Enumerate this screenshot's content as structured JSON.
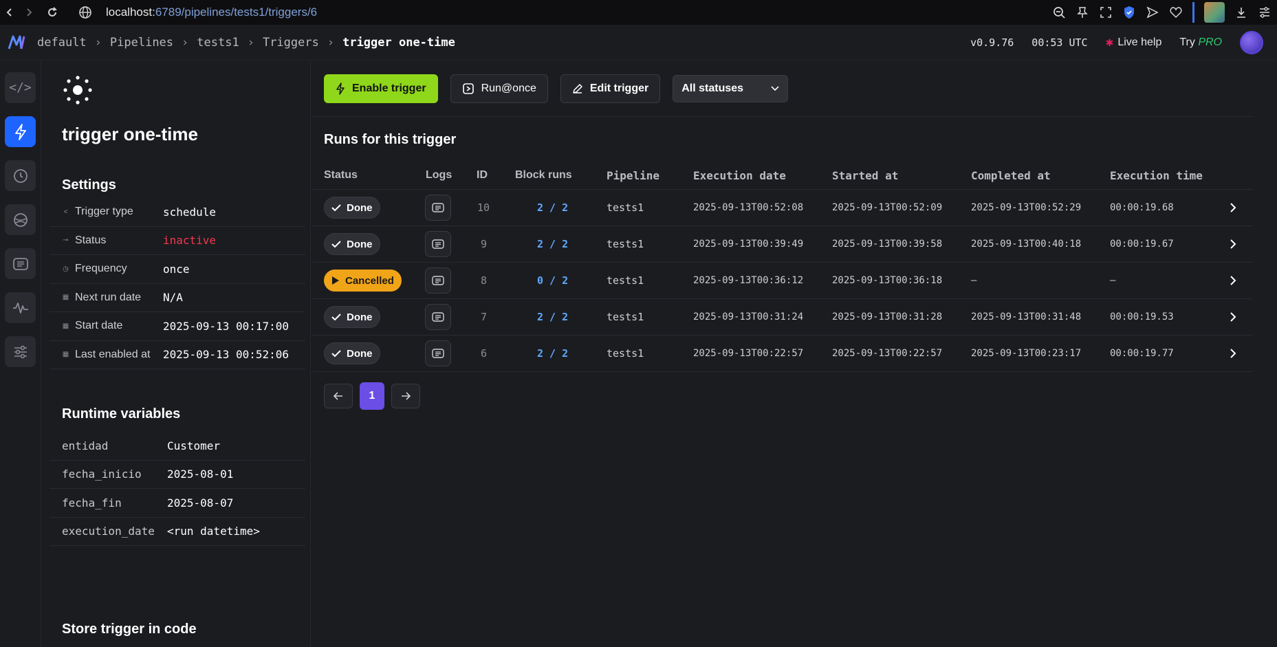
{
  "browser": {
    "url_host": "localhost:",
    "url_rest": "6789/pipelines/tests1/triggers/6"
  },
  "header": {
    "breadcrumbs": [
      "default",
      "Pipelines",
      "tests1",
      "Triggers",
      "trigger one-time"
    ],
    "version": "v0.9.76",
    "time": "00:53 UTC",
    "live_help": "Live help",
    "try_label": "Try",
    "pro_label": "PRO"
  },
  "trigger": {
    "title": "trigger one-time",
    "settings_title": "Settings",
    "settings": [
      {
        "key": "Trigger type",
        "value": "schedule",
        "icon": "share-icon"
      },
      {
        "key": "Status",
        "value": "inactive",
        "icon": "toggle-icon"
      },
      {
        "key": "Frequency",
        "value": "once",
        "icon": "clock-icon"
      },
      {
        "key": "Next run date",
        "value": "N/A",
        "icon": "calendar-icon"
      },
      {
        "key": "Start date",
        "value": "2025-09-13 00:17:00",
        "icon": "calendar-icon"
      },
      {
        "key": "Last enabled at",
        "value": "2025-09-13 00:52:06",
        "icon": "calendar-icon"
      }
    ],
    "runtime_title": "Runtime variables",
    "runtime_vars": [
      {
        "key": "entidad",
        "value": "Customer"
      },
      {
        "key": "fecha_inicio",
        "value": "2025-08-01"
      },
      {
        "key": "fecha_fin",
        "value": "2025-08-07"
      },
      {
        "key": "execution_date",
        "value": "<run datetime>"
      }
    ],
    "store_title": "Store trigger in code"
  },
  "toolbar": {
    "enable_label": "Enable trigger",
    "run_label": "Run@once",
    "edit_label": "Edit trigger",
    "status_filter": "All statuses"
  },
  "runs": {
    "title": "Runs for this trigger",
    "columns": [
      "Status",
      "Logs",
      "ID",
      "Block runs",
      "Pipeline",
      "Execution date",
      "Started at",
      "Completed at",
      "Execution time"
    ],
    "rows": [
      {
        "status": "Done",
        "id": "10",
        "blocks": "2 / 2",
        "pipeline": "tests1",
        "exec": "2025-09-13T00:52:08",
        "started": "2025-09-13T00:52:09",
        "completed": "2025-09-13T00:52:29",
        "time": "00:00:19.68"
      },
      {
        "status": "Done",
        "id": "9",
        "blocks": "2 / 2",
        "pipeline": "tests1",
        "exec": "2025-09-13T00:39:49",
        "started": "2025-09-13T00:39:58",
        "completed": "2025-09-13T00:40:18",
        "time": "00:00:19.67"
      },
      {
        "status": "Cancelled",
        "id": "8",
        "blocks": "0 / 2",
        "pipeline": "tests1",
        "exec": "2025-09-13T00:36:12",
        "started": "2025-09-13T00:36:18",
        "completed": "—",
        "time": "—"
      },
      {
        "status": "Done",
        "id": "7",
        "blocks": "2 / 2",
        "pipeline": "tests1",
        "exec": "2025-09-13T00:31:24",
        "started": "2025-09-13T00:31:28",
        "completed": "2025-09-13T00:31:48",
        "time": "00:00:19.53"
      },
      {
        "status": "Done",
        "id": "6",
        "blocks": "2 / 2",
        "pipeline": "tests1",
        "exec": "2025-09-13T00:22:57",
        "started": "2025-09-13T00:22:57",
        "completed": "2025-09-13T00:23:17",
        "time": "00:00:19.77"
      }
    ]
  },
  "pager": {
    "current": "1"
  },
  "colors": {
    "primary_button": "#8fd71a",
    "active_nav": "#1e64ff",
    "inactive_status": "#f0394d",
    "cancelled": "#f0a417",
    "block_runs": "#5fa8ff",
    "current_page": "#6b4ee6"
  }
}
